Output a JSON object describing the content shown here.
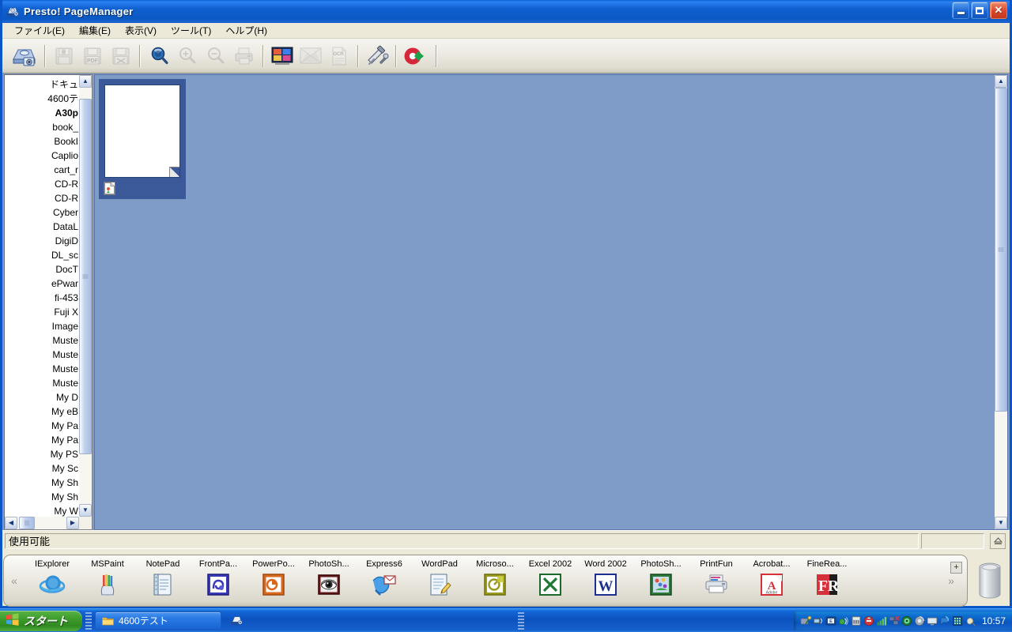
{
  "window": {
    "title": "Presto! PageManager",
    "title_icon": "scanner-app-icon",
    "controls": {
      "minimize": "–",
      "maximize": "□",
      "close": "✕"
    }
  },
  "menubar": {
    "items": [
      {
        "label": "ファイル(E)",
        "name": "menu-file"
      },
      {
        "label": "編集(E)",
        "name": "menu-edit"
      },
      {
        "label": "表示(V)",
        "name": "menu-view"
      },
      {
        "label": "ツール(T)",
        "name": "menu-tools"
      },
      {
        "label": "ヘルプ(H)",
        "name": "menu-help"
      }
    ]
  },
  "toolbar": {
    "buttons": [
      {
        "name": "acquire-scan-button",
        "icon": "scanner-icon",
        "enabled": true
      },
      {
        "name": "save-button",
        "icon": "floppy-save-icon",
        "enabled": false
      },
      {
        "name": "save-pdf-button",
        "icon": "floppy-pdf-icon",
        "enabled": false
      },
      {
        "name": "save-as-button",
        "icon": "floppy-export-icon",
        "enabled": false
      },
      {
        "name": "preview-search-button",
        "icon": "magnifier-icon",
        "enabled": true
      },
      {
        "name": "zoom-in-button",
        "icon": "zoom-in-icon",
        "enabled": false
      },
      {
        "name": "zoom-out-button",
        "icon": "zoom-out-icon",
        "enabled": false
      },
      {
        "name": "print-button",
        "icon": "printer-icon",
        "enabled": false
      },
      {
        "name": "thumbnail-view-button",
        "icon": "thumbnail-grid-icon",
        "enabled": true
      },
      {
        "name": "slideshow-button",
        "icon": "slideshow-icon",
        "enabled": false
      },
      {
        "name": "ocr-button",
        "icon": "ocr-icon",
        "enabled": false,
        "label": "OCR"
      },
      {
        "name": "tools-button",
        "icon": "hammer-wrench-icon",
        "enabled": true
      },
      {
        "name": "presto-logo-button",
        "icon": "presto-logo-icon",
        "enabled": true
      }
    ]
  },
  "tree": {
    "items": [
      {
        "label": "ドキュ",
        "bold": false
      },
      {
        "label": "4600テ",
        "bold": false
      },
      {
        "label": "A30p",
        "bold": true
      },
      {
        "label": "book_",
        "bold": false
      },
      {
        "label": "BookI",
        "bold": false
      },
      {
        "label": "Caplio",
        "bold": false
      },
      {
        "label": "cart_r",
        "bold": false
      },
      {
        "label": "CD-R",
        "bold": false
      },
      {
        "label": "CD-R",
        "bold": false
      },
      {
        "label": "Cyber",
        "bold": false
      },
      {
        "label": "DataL",
        "bold": false
      },
      {
        "label": "DigiD",
        "bold": false
      },
      {
        "label": "DL_sc",
        "bold": false
      },
      {
        "label": "DocT",
        "bold": false
      },
      {
        "label": "ePwar",
        "bold": false
      },
      {
        "label": "fi-453",
        "bold": false
      },
      {
        "label": "Fuji X",
        "bold": false
      },
      {
        "label": "Image",
        "bold": false
      },
      {
        "label": "Muste",
        "bold": false
      },
      {
        "label": "Muste",
        "bold": false
      },
      {
        "label": "Muste",
        "bold": false
      },
      {
        "label": "Muste",
        "bold": false
      },
      {
        "label": "My D",
        "bold": false
      },
      {
        "label": "My eB",
        "bold": false
      },
      {
        "label": "My Pa",
        "bold": false
      },
      {
        "label": "My Pa",
        "bold": false
      },
      {
        "label": "My PS",
        "bold": false
      },
      {
        "label": "My Sc",
        "bold": false
      },
      {
        "label": "My Sh",
        "bold": false
      },
      {
        "label": "My Sh",
        "bold": false
      },
      {
        "label": "My W",
        "bold": false
      }
    ]
  },
  "main": {
    "thumbnails": [
      {
        "name": "document-thumbnail",
        "selected": true,
        "file_icon": "image-file-icon",
        "label": ""
      }
    ]
  },
  "statusbar": {
    "message": "使用可能",
    "panel2": "",
    "panel3": "",
    "eject_icon": "eject-icon"
  },
  "launchbar": {
    "scroll_left": "«",
    "scroll_right": "»",
    "add_label": "+",
    "trash_icon": "trash-can-icon",
    "items": [
      {
        "label": "IExplorer",
        "icon": "internet-explorer-icon"
      },
      {
        "label": "MSPaint",
        "icon": "ms-paint-icon"
      },
      {
        "label": "NotePad",
        "icon": "notepad-icon"
      },
      {
        "label": "FrontPa...",
        "icon": "frontpage-icon"
      },
      {
        "label": "PowerPo...",
        "icon": "powerpoint-icon"
      },
      {
        "label": "PhotoSh...",
        "icon": "photoshop-eye-icon"
      },
      {
        "label": "Express6",
        "icon": "outlook-express-icon"
      },
      {
        "label": "WordPad",
        "icon": "wordpad-icon"
      },
      {
        "label": "Microso...",
        "icon": "microsoft-office-icon"
      },
      {
        "label": "Excel 2002",
        "icon": "excel-icon"
      },
      {
        "label": "Word 2002",
        "icon": "word-icon"
      },
      {
        "label": "PhotoSh...",
        "icon": "photoshop-icon"
      },
      {
        "label": "PrintFun",
        "icon": "printer-fun-icon"
      },
      {
        "label": "Acrobat...",
        "icon": "acrobat-icon"
      },
      {
        "label": "FineRea...",
        "icon": "finereader-icon"
      }
    ]
  },
  "taskbar": {
    "start_label": "スタート",
    "start_icon": "windows-flag-icon",
    "tasks": [
      {
        "label": "4600テスト",
        "icon": "folder-icon",
        "active": true
      },
      {
        "label": "",
        "icon": "presto-pagemanager-icon",
        "active": false
      }
    ],
    "tray": {
      "time": "10:57",
      "icons": [
        "bluetooth-icon",
        "network-monitor-icon",
        "ime-icon",
        "sound-scheme-icon",
        "calculator-icon",
        "safely-remove-icon",
        "signal-bars-icon",
        "network-disconnected-icon",
        "antivirus-icon",
        "audio-icon",
        "display-icon",
        "messenger-icon",
        "grid-icon",
        "mouse-icon"
      ]
    }
  },
  "colors": {
    "title_blue": "#0a58c2",
    "desktop_blue": "#3a6ea5",
    "workspace_blue": "#7f9cc8",
    "selection_navy": "#3b5998",
    "face": "#ece9d8",
    "start_green": "#3d9c2c"
  }
}
